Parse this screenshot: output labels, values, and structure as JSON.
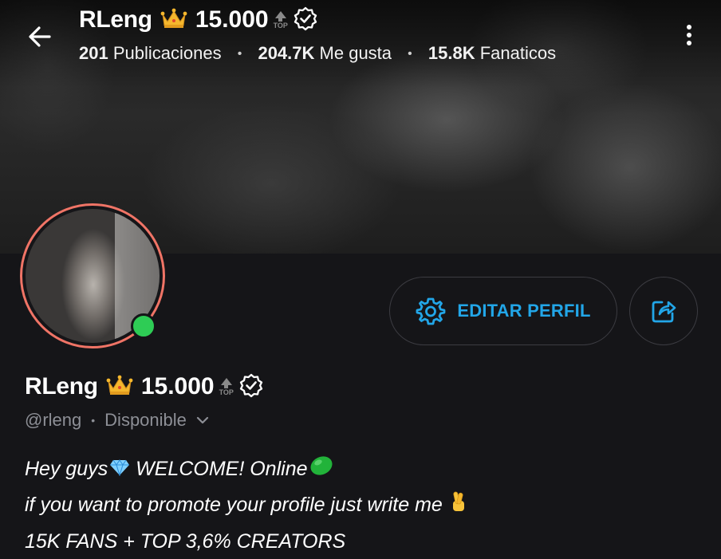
{
  "header": {
    "name": "RLeng",
    "count": "15.000",
    "top_badge_text": "TOP",
    "stats": [
      {
        "value": "201",
        "label": "Publicaciones"
      },
      {
        "value": "204.7K",
        "label": "Me gusta"
      },
      {
        "value": "15.8K",
        "label": "Fanaticos"
      }
    ]
  },
  "profile": {
    "name": "RLeng",
    "count": "15.000",
    "top_badge_text": "TOP",
    "handle": "@rleng",
    "status": "Disponible",
    "online": true
  },
  "actions": {
    "edit_label": "EDITAR PERFIL"
  },
  "bio": {
    "line1": "Hey guys",
    "line1b": " WELCOME! Online",
    "line2": "if you want to promote your profile just write me ",
    "line3": "15K FANS + TOP 3,6% CREATORS"
  },
  "colors": {
    "accent": "#22a6e8",
    "online": "#2ecc55",
    "avatar_ring": "#f07466",
    "background": "#151518"
  },
  "icons": [
    "back-arrow-icon",
    "crown-icon",
    "top-arrow-icon",
    "verified-icon",
    "more-vertical-icon",
    "gear-icon",
    "share-icon",
    "chevron-down-icon",
    "diamond-icon",
    "green-heart-icon",
    "crossed-fingers-icon"
  ]
}
